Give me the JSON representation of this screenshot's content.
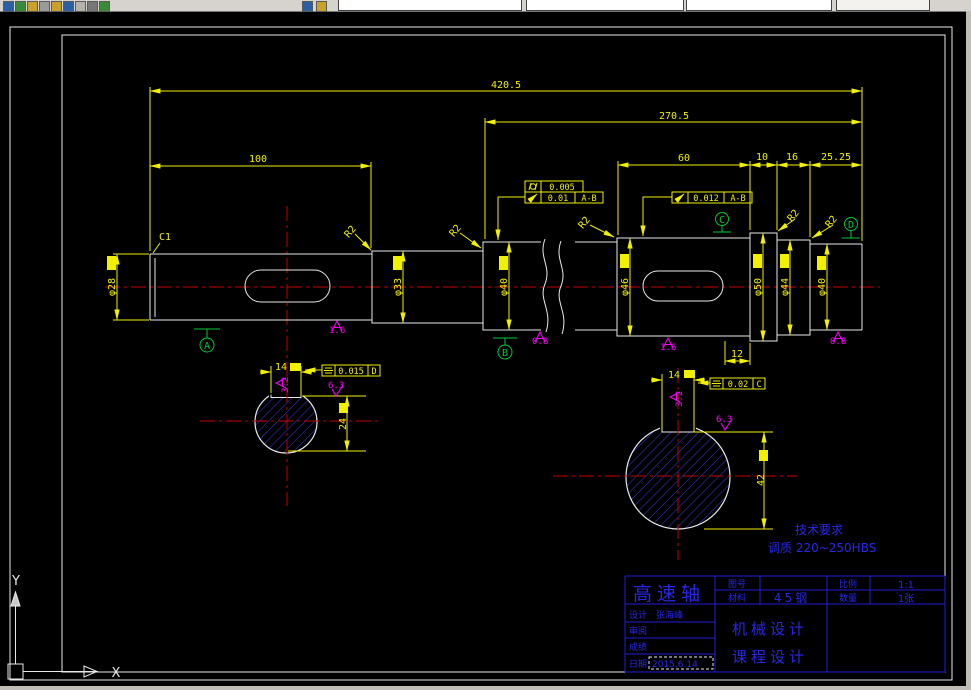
{
  "drawing": {
    "dims": {
      "overall": "420.5",
      "right_span": "270.5",
      "left_len": "100",
      "gear_len": "60",
      "step_len": "10",
      "bearing_len": "16",
      "end_len": "25.25",
      "key_offset": "12"
    },
    "diameters": {
      "d28": "φ28",
      "d33": "φ33",
      "d40a": "φ40",
      "d46": "φ46",
      "d50": "φ50",
      "d44": "φ44",
      "d40b": "φ40"
    },
    "chamfer": "C1",
    "fillet": "R2",
    "datum_labels": {
      "a": "A",
      "b": "B",
      "c": "C",
      "d": "D"
    },
    "gdt": {
      "cylindricity": "0.005",
      "runout1_val": "0.01",
      "runout1_datum": "A-B",
      "runout2_val": "0.012",
      "runout2_datum": "A-B",
      "sym1_val": "0.015",
      "sym1_datum": "D",
      "sym2_val": "0.02",
      "sym2_datum": "C"
    },
    "roughness": {
      "r1": "1.6",
      "r2": "0.8",
      "r3": "1.6",
      "r4": "0.8"
    },
    "section_a": {
      "key_width": "14",
      "height": "24",
      "rough_side": "3.2",
      "rough_bottom": "6.3"
    },
    "section_b": {
      "key_width": "14",
      "height": "42",
      "rough_side": "3.2",
      "rough_bottom": "6.3"
    },
    "tech_req_title": "技术要求",
    "tech_req_line": "调质 220~250HBS"
  },
  "title_block": {
    "part_name": "高速轴",
    "drawing_no_label": "图号",
    "material_label": "材料",
    "material_value": "45钢",
    "scale_label": "比例",
    "scale_value": "1:1",
    "qty_label": "数量",
    "qty_value": "1张",
    "designer_label": "设计",
    "designer_value": "张海峰",
    "checker_label": "审阅",
    "grade_label": "成绩",
    "date_label": "日期",
    "date_value": "2015.6.14",
    "course_line1": "机械设计",
    "course_line2": "课程设计"
  },
  "ucs": {
    "x": "X",
    "y": "Y"
  }
}
